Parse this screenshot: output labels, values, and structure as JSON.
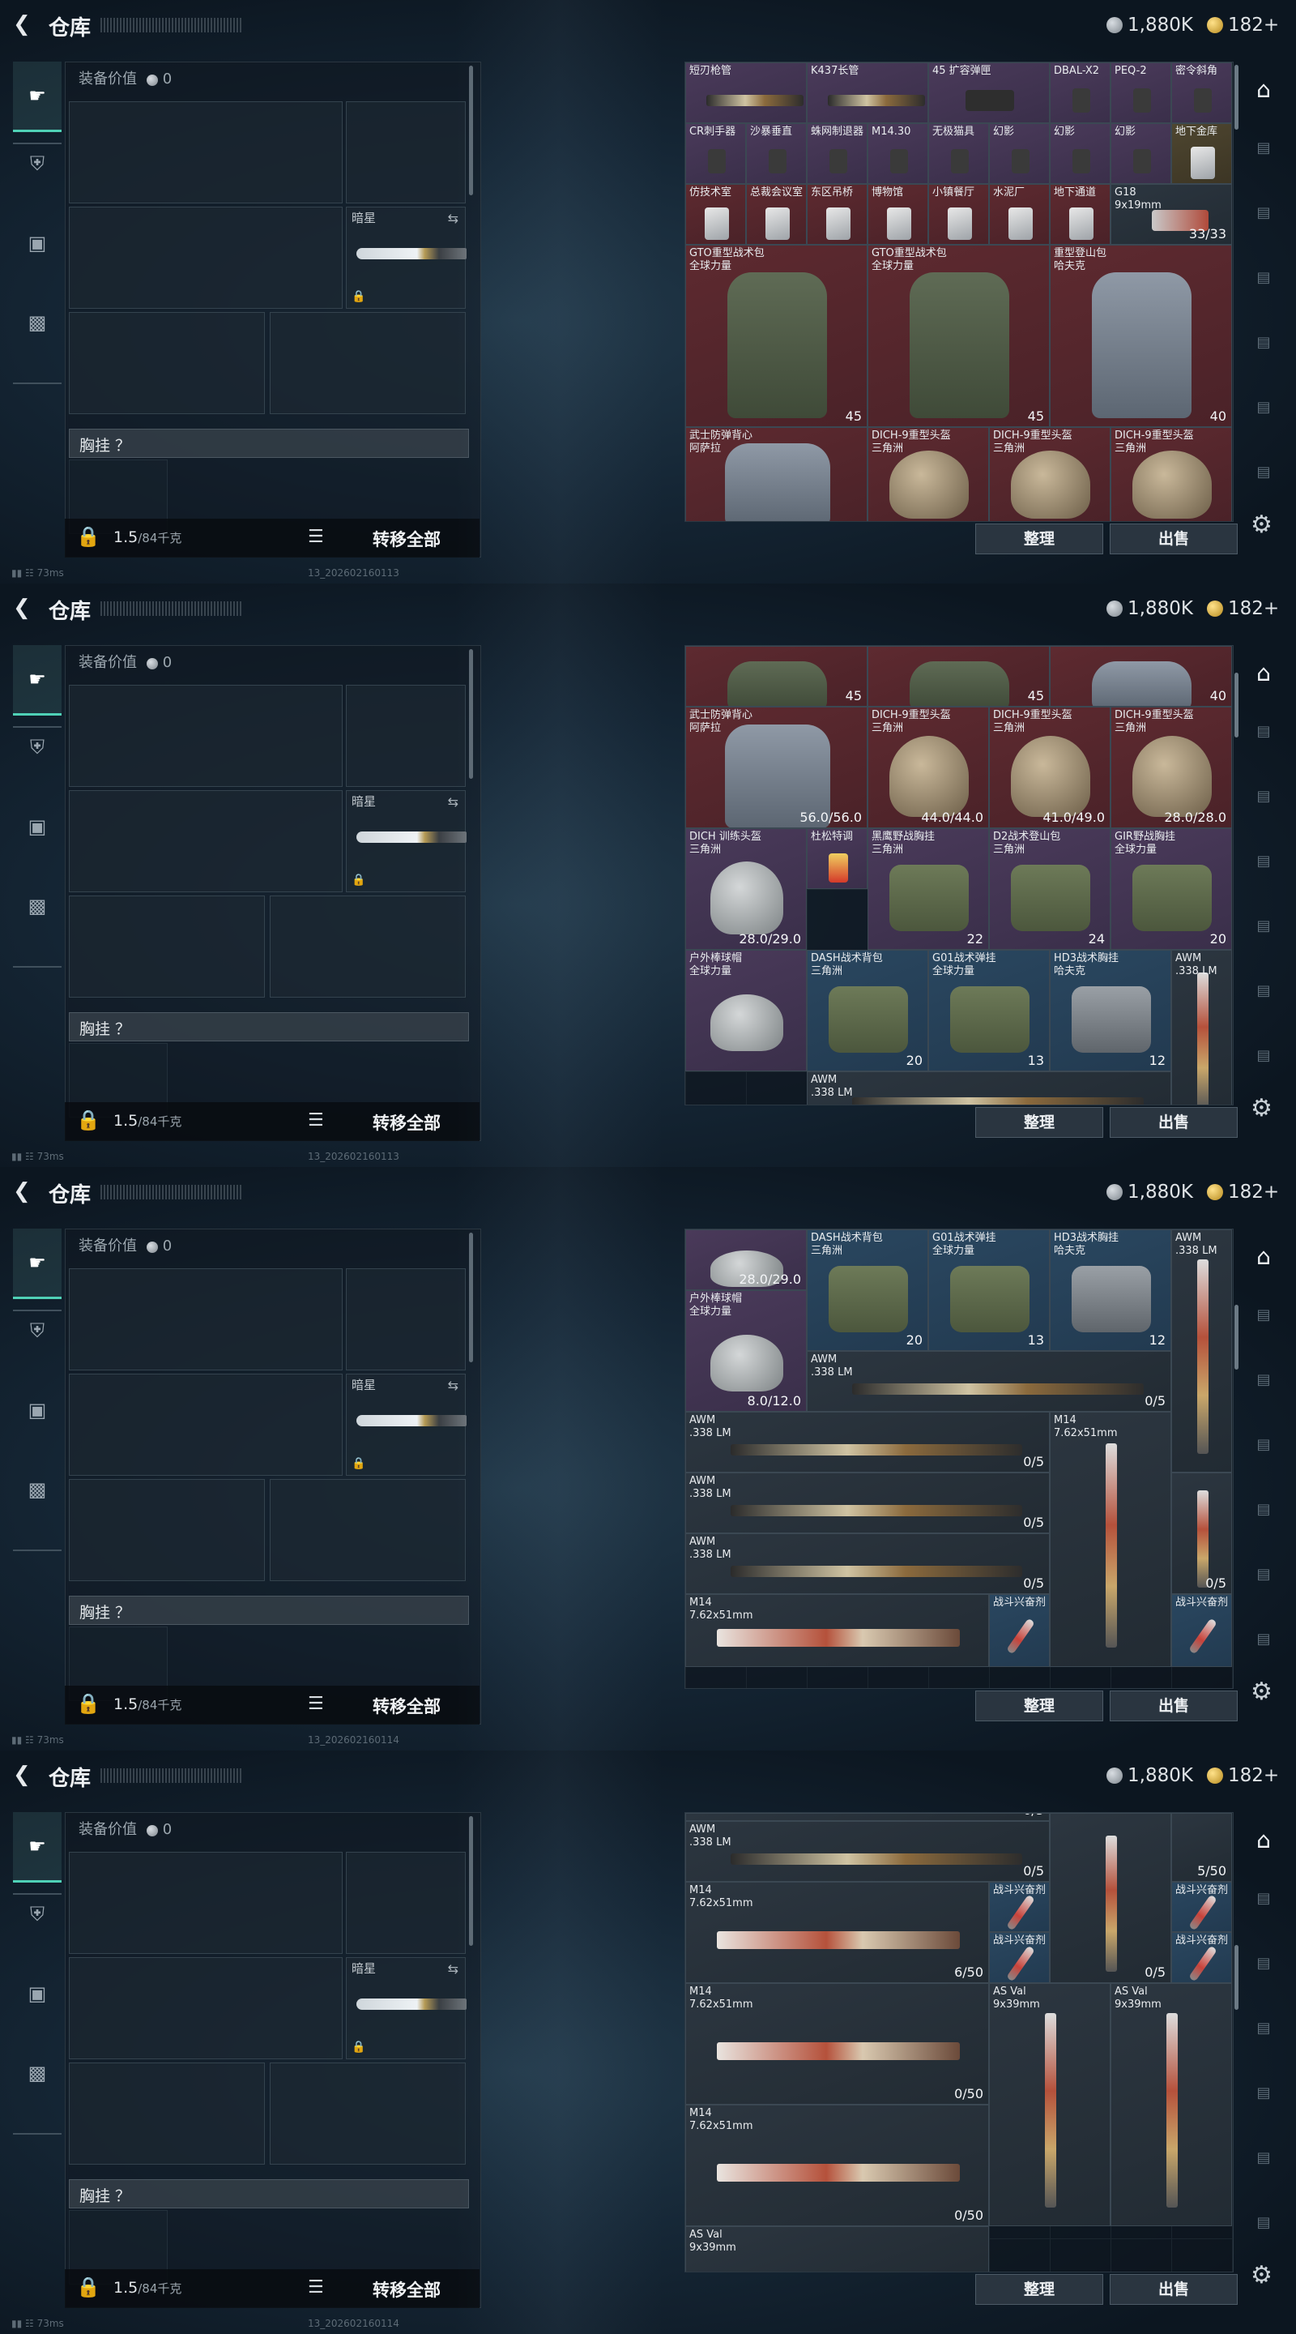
{
  "header": {
    "title": "仓库",
    "silver": "1,880K",
    "gold": "182+"
  },
  "side_tabs": [
    "weapon",
    "helmet",
    "backpack",
    "briefcase"
  ],
  "loadout": {
    "value_label": "装备价值",
    "value": "0",
    "melee_name": "暗星",
    "vest_slot_label": "胸挂 ？",
    "weight": "1.5",
    "capacity": "/84千克",
    "transfer_all": "转移全部"
  },
  "status": {
    "ping": "73ms"
  },
  "timestamps": [
    "13_202602160113",
    "13_202602160113",
    "13_202602160114",
    "13_202602160114"
  ],
  "actions": {
    "sort": "整理",
    "sell": "出售"
  },
  "colors": {
    "accent": "#4fd1b6",
    "purple": "#4a3a5a",
    "red": "#5e2a30",
    "blue": "#2a4760",
    "gold": "#b78a1e"
  },
  "stash": {
    "s1": [
      {
        "name": "短刃枪管",
        "count": ""
      },
      {
        "name": "K437长管",
        "count": ""
      },
      {
        "name": "45 扩容弹匣",
        "count": ""
      },
      {
        "name": "DBAL-X2",
        "count": ""
      },
      {
        "name": "PEQ-2",
        "count": ""
      },
      {
        "name": "密令斜角",
        "count": ""
      },
      {
        "name": "CR刺手器",
        "count": ""
      },
      {
        "name": "沙暴垂直",
        "count": ""
      },
      {
        "name": "蛛网制退器",
        "count": ""
      },
      {
        "name": "M14.30",
        "count": ""
      },
      {
        "name": "无极猫具",
        "count": ""
      },
      {
        "name": "幻影",
        "count": ""
      },
      {
        "name": "幻影",
        "count": ""
      },
      {
        "name": "幻影",
        "count": ""
      },
      {
        "name": "地下金库",
        "count": ""
      },
      {
        "name": "仿技术室",
        "count": ""
      },
      {
        "name": "总裁会议室",
        "count": ""
      },
      {
        "name": "东区吊桥",
        "count": ""
      },
      {
        "name": "博物馆",
        "count": ""
      },
      {
        "name": "小镇餐厅",
        "count": ""
      },
      {
        "name": "水泥厂",
        "count": ""
      },
      {
        "name": "地下通道",
        "count": ""
      },
      {
        "name": "G18\n9x19mm",
        "count": "33/33"
      },
      {
        "name": "GTO重型战术包\n全球力量",
        "count": "45"
      },
      {
        "name": "GTO重型战术包\n全球力量",
        "count": "45"
      },
      {
        "name": "重型登山包\n哈夫克",
        "count": "40"
      },
      {
        "name": "武士防弹背心\n阿萨拉",
        "count": ""
      },
      {
        "name": "DICH-9重型头盔\n三角洲",
        "count": ""
      },
      {
        "name": "DICH-9重型头盔\n三角洲",
        "count": ""
      },
      {
        "name": "DICH-9重型头盔\n三角洲",
        "count": ""
      }
    ],
    "s2": [
      {
        "name": "",
        "count": "45"
      },
      {
        "name": "",
        "count": "45"
      },
      {
        "name": "",
        "count": "40"
      },
      {
        "name": "武士防弹背心\n阿萨拉",
        "count": "56.0/56.0"
      },
      {
        "name": "DICH-9重型头盔\n三角洲",
        "count": "44.0/44.0"
      },
      {
        "name": "DICH-9重型头盔\n三角洲",
        "count": "41.0/49.0"
      },
      {
        "name": "DICH-9重型头盔\n三角洲",
        "count": "28.0/28.0"
      },
      {
        "name": "DICH 训练头盔\n三角洲",
        "count": "28.0/29.0"
      },
      {
        "name": "杜松特调",
        "count": ""
      },
      {
        "name": "黑鹰野战胸挂\n三角洲",
        "count": "22"
      },
      {
        "name": "D2战术登山包\n三角洲",
        "count": "24"
      },
      {
        "name": "GIR野战胸挂\n全球力量",
        "count": "20"
      },
      {
        "name": "户外棒球帽\n全球力量",
        "count": ""
      },
      {
        "name": "DASH战术背包\n三角洲",
        "count": "20"
      },
      {
        "name": "G01战术弹挂\n全球力量",
        "count": "13"
      },
      {
        "name": "HD3战术胸挂\n哈夫克",
        "count": "12"
      },
      {
        "name": "AWM\n.338 LM",
        "count": ""
      },
      {
        "name": "AWM\n.338 LM",
        "count": ""
      }
    ],
    "s3": [
      {
        "name": "",
        "count": "28.0/29.0"
      },
      {
        "name": "DASH战术背包\n三角洲",
        "count": "20"
      },
      {
        "name": "G01战术弹挂\n全球力量",
        "count": "13"
      },
      {
        "name": "HD3战术胸挂\n哈夫克",
        "count": "12"
      },
      {
        "name": "AWM\n.338 LM",
        "count": ""
      },
      {
        "name": "户外棒球帽\n全球力量",
        "count": "8.0/12.0"
      },
      {
        "name": "AWM\n.338 LM",
        "count": "0/5"
      },
      {
        "name": "AWM\n.338 LM",
        "count": "0/5"
      },
      {
        "name": "M14\n7.62x51mm",
        "count": ""
      },
      {
        "name": "AWM\n.338 LM",
        "count": "0/5"
      },
      {
        "name": "AWM\n.338 LM",
        "count": "0/5"
      },
      {
        "name": "M14\n7.62x51mm",
        "count": ""
      },
      {
        "name": "战斗兴奋剂",
        "count": ""
      },
      {
        "name": "战斗兴奋剂",
        "count": ""
      },
      {
        "name": "",
        "count": "0/5"
      }
    ],
    "s4": [
      {
        "name": "",
        "count": "0/5"
      },
      {
        "name": "AWM\n.338 LM",
        "count": "0/5"
      },
      {
        "name": "",
        "count": "0/5"
      },
      {
        "name": "M14\n7.62x51mm",
        "count": "6/50"
      },
      {
        "name": "战斗兴奋剂",
        "count": ""
      },
      {
        "name": "战斗兴奋剂",
        "count": ""
      },
      {
        "name": "战斗兴奋剂",
        "count": ""
      },
      {
        "name": "战斗兴奋剂",
        "count": ""
      },
      {
        "name": "",
        "count": "5/50"
      },
      {
        "name": "M14\n7.62x51mm",
        "count": "0/50"
      },
      {
        "name": "AS Val\n9x39mm",
        "count": ""
      },
      {
        "name": "AS Val\n9x39mm",
        "count": ""
      },
      {
        "name": "M14\n7.62x51mm",
        "count": "0/50"
      },
      {
        "name": "AS Val\n9x39mm",
        "count": ""
      }
    ]
  }
}
